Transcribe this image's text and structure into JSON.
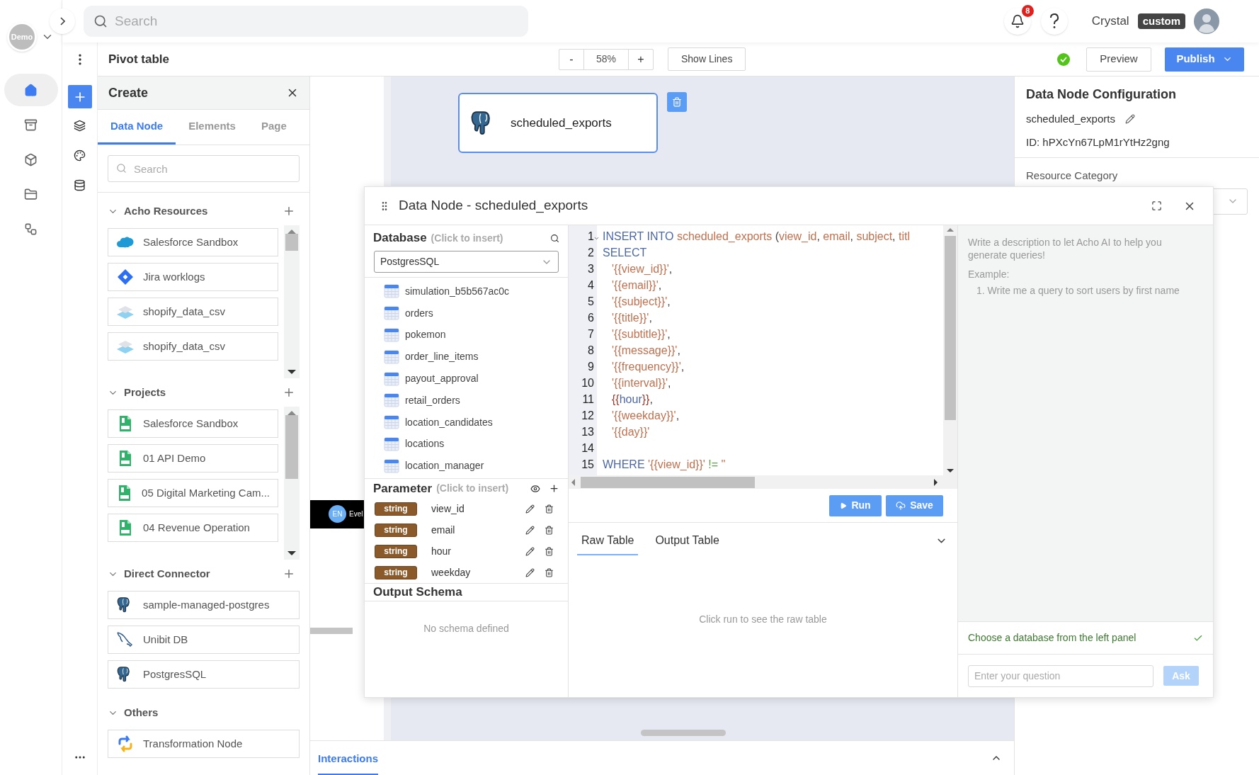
{
  "workspace": {
    "label": "Demo"
  },
  "nav_items": [
    {
      "selected": true
    },
    {
      "selected": false
    },
    {
      "selected": false
    },
    {
      "selected": false
    },
    {
      "selected": false
    }
  ],
  "top_bar": {
    "search": {
      "placeholder": "Search"
    },
    "notifications": "8",
    "user_name": "Crystal",
    "role": "custom"
  },
  "header": {
    "title": "Pivot table",
    "zoom": {
      "minus": "-",
      "value": "58%",
      "plus": "+"
    },
    "show_lines": "Show Lines",
    "saved": true,
    "preview": "Preview",
    "publish": "Publish"
  },
  "create_panel": {
    "title": "Create",
    "tabs": [
      {
        "label": "Data Node",
        "selected": true
      },
      {
        "label": "Elements",
        "selected": false
      },
      {
        "label": "Page",
        "selected": false
      }
    ],
    "search": {
      "placeholder": "Search"
    },
    "sections": [
      {
        "title": "Acho Resources",
        "addable": true,
        "scrollable": true,
        "items": [
          {
            "kind": "salesforce",
            "label": "Salesforce Sandbox"
          },
          {
            "kind": "jira",
            "label": "Jira worklogs"
          },
          {
            "kind": "csv",
            "label": "shopify_data_csv"
          },
          {
            "kind": "csv",
            "label": "shopify_data_csv"
          }
        ]
      },
      {
        "title": "Projects",
        "addable": true,
        "scrollable": true,
        "items": [
          {
            "kind": "project",
            "label": "Salesforce Sandbox"
          },
          {
            "kind": "project",
            "label": "01 API Demo"
          },
          {
            "kind": "project",
            "label": "05 Digital Marketing Cam..."
          },
          {
            "kind": "project",
            "label": "04 Revenue Operation"
          }
        ]
      },
      {
        "title": "Direct Connector",
        "addable": true,
        "items": [
          {
            "kind": "postgres",
            "label": "sample-managed-postgres"
          },
          {
            "kind": "mysql",
            "label": "Unibit DB"
          },
          {
            "kind": "postgres",
            "label": "PostgresSQL"
          }
        ]
      },
      {
        "title": "Others",
        "items": [
          {
            "kind": "transform",
            "label": "Transformation Node"
          }
        ]
      }
    ]
  },
  "canvas": {
    "node": {
      "kind": "postgres",
      "label": "scheduled_exports",
      "selected": true
    },
    "page_strip": {
      "badge": "EN",
      "text": "Evel"
    }
  },
  "bottom_panel": {
    "tabs": [
      {
        "label": "Interactions",
        "selected": true
      }
    ]
  },
  "config": {
    "title": "Data Node Configuration",
    "name": "scheduled_exports",
    "id": "ID: hPXcYn67LpM1rYtHz2gng",
    "resource_category": "Resource Category"
  },
  "modal": {
    "title": "Data Node - scheduled_exports",
    "database": {
      "title": "Database",
      "hint": "(Click to insert)",
      "selected_db": "PostgresSQL",
      "tables": [
        "simulation_b5b567ac0c",
        "orders",
        "pokemon",
        "order_line_items",
        "payout_approval",
        "retail_orders",
        "location_candidates",
        "locations",
        "location_manager"
      ]
    },
    "parameters": {
      "title": "Parameter",
      "hint": "(Click to insert)",
      "items": [
        {
          "type": "string",
          "name": "view_id"
        },
        {
          "type": "string",
          "name": "email"
        },
        {
          "type": "string",
          "name": "hour"
        },
        {
          "type": "string",
          "name": "weekday"
        }
      ]
    },
    "output_schema": {
      "title": "Output Schema",
      "empty": "No schema defined"
    },
    "code_lines": [
      {
        "number": "1",
        "foldable": true,
        "tokens": [
          {
            "kind": "keyword",
            "text": "INSERT INTO "
          },
          {
            "kind": "ident",
            "text": "scheduled_exports"
          },
          {
            "kind": "punct",
            "text": " ("
          },
          {
            "kind": "ident",
            "text": "view_id"
          },
          {
            "kind": "punct",
            "text": ", "
          },
          {
            "kind": "ident",
            "text": "email"
          },
          {
            "kind": "punct",
            "text": ", "
          },
          {
            "kind": "ident",
            "text": "subject"
          },
          {
            "kind": "punct",
            "text": ", "
          },
          {
            "kind": "ident",
            "text": "titl"
          }
        ]
      },
      {
        "number": "2",
        "tokens": [
          {
            "kind": "keyword",
            "text": "SELECT"
          }
        ]
      },
      {
        "number": "3",
        "indent": true,
        "tokens": [
          {
            "kind": "ident",
            "text": "'{{view_id}}'"
          },
          {
            "kind": "punct",
            "text": ","
          }
        ]
      },
      {
        "number": "4",
        "indent": true,
        "tokens": [
          {
            "kind": "ident",
            "text": "'{{email}}'"
          },
          {
            "kind": "punct",
            "text": ","
          }
        ]
      },
      {
        "number": "5",
        "indent": true,
        "tokens": [
          {
            "kind": "ident",
            "text": "'{{subject}}'"
          },
          {
            "kind": "punct",
            "text": ","
          }
        ]
      },
      {
        "number": "6",
        "indent": true,
        "tokens": [
          {
            "kind": "ident",
            "text": "'{{title}}'"
          },
          {
            "kind": "punct",
            "text": ","
          }
        ]
      },
      {
        "number": "7",
        "indent": true,
        "tokens": [
          {
            "kind": "ident",
            "text": "'{{subtitle}}'"
          },
          {
            "kind": "punct",
            "text": ","
          }
        ]
      },
      {
        "number": "8",
        "indent": true,
        "tokens": [
          {
            "kind": "ident",
            "text": "'{{message}}'"
          },
          {
            "kind": "punct",
            "text": ","
          }
        ]
      },
      {
        "number": "9",
        "indent": true,
        "tokens": [
          {
            "kind": "ident",
            "text": "'{{frequency}}'"
          },
          {
            "kind": "punct",
            "text": ","
          }
        ]
      },
      {
        "number": "10",
        "indent": true,
        "tokens": [
          {
            "kind": "ident",
            "text": "'{{interval}}'"
          },
          {
            "kind": "punct",
            "text": ","
          }
        ]
      },
      {
        "number": "11",
        "indent": true,
        "tokens": [
          {
            "kind": "brace",
            "text": "{{"
          },
          {
            "kind": "keyword",
            "text": "hour"
          },
          {
            "kind": "brace",
            "text": "}}"
          },
          {
            "kind": "punct",
            "text": ","
          }
        ]
      },
      {
        "number": "12",
        "indent": true,
        "tokens": [
          {
            "kind": "ident",
            "text": "'{{weekday}}'"
          },
          {
            "kind": "punct",
            "text": ","
          }
        ]
      },
      {
        "number": "13",
        "indent": true,
        "tokens": [
          {
            "kind": "ident",
            "text": "'{{day}}'"
          }
        ]
      },
      {
        "number": "14"
      },
      {
        "number": "15",
        "tokens": [
          {
            "kind": "keyword",
            "text": "WHERE "
          },
          {
            "kind": "ident",
            "text": "'{{view_id}}'"
          },
          {
            "kind": "op",
            "text": " != "
          },
          {
            "kind": "ident",
            "text": "''"
          }
        ]
      }
    ],
    "run": "Run",
    "save": "Save",
    "result_tabs": [
      {
        "label": "Raw Table",
        "selected": true
      },
      {
        "label": "Output Table",
        "selected": false
      }
    ],
    "result_empty": "Click run to see the raw table",
    "ai": {
      "description": "Write a description to let Acho AI to help you generate queries!",
      "example_label": "Example:",
      "examples": [
        "1. Write me a query to sort users by first name"
      ],
      "status": "Choose a database from the left panel",
      "question": {
        "placeholder": "Enter your question"
      },
      "ask": "Ask",
      "ask_disabled": true
    }
  }
}
